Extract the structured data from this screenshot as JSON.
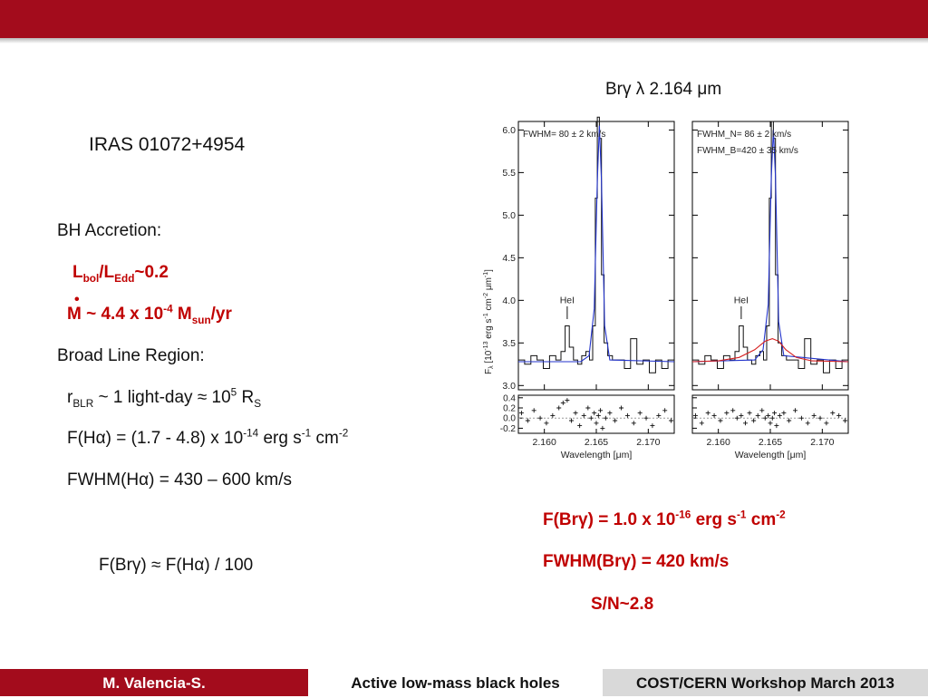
{
  "colors": {
    "brand": "#a30c1c",
    "highlight": "#c00000",
    "fit_line": "#2233cc",
    "broad_component": "#d62020"
  },
  "object_name": "IRAS 01072+4954",
  "bh_accretion": {
    "heading": "BH Accretion:",
    "lratio_L1": "L",
    "lratio_s1": "bol",
    "lratio_slash": "/L",
    "lratio_s2": "Edd",
    "lratio_val": "~0.2",
    "mdot_pre": "M ~ 4.4 x 10",
    "mdot_exp": "-4",
    "mdot_mid": " M",
    "mdot_sub": "sun",
    "mdot_post": "/yr"
  },
  "blr": {
    "heading": "Broad Line Region:",
    "r_pre": "r",
    "r_sub": "BLR",
    "r_mid": " ~ 1 light-day ≈ 10",
    "r_exp": "5",
    "r_mid2": " R",
    "r_sub2": "S",
    "f_pre": "F(Hα) = (1.7 - 4.8) x 10",
    "f_exp1": "-14",
    "f_mid": " erg s",
    "f_exp2": "-1",
    "f_mid2": " cm",
    "f_exp3": "-2",
    "fwhm": "FWHM(Hα) = 430 – 600 km/s"
  },
  "flux_ratio": "F(Brγ) ≈ F(Hα) / 100",
  "brg_title": "Brγ λ 2.164 μm",
  "results": {
    "f_pre": "F(Brγ) = 1.0 x 10",
    "f_exp1": "-16",
    "f_mid": " erg s",
    "f_exp2": "-1",
    "f_mid2": " cm",
    "f_exp3": "-2",
    "fwhm": "FWHM(Brγ) = 420 km/s",
    "sn": "S/N~2.8"
  },
  "footer": {
    "author": "M. Valencia-S.",
    "title": "Active low-mass black holes",
    "event": "COST/CERN Workshop March 2013"
  },
  "chart_data": [
    {
      "type": "line",
      "panel": "left",
      "annotation_fwhm": "FWHM= 80 ± 2 km/s",
      "line_label": "HeI",
      "line_label_x": 2.1622,
      "ylabel": "F_λ [10^-13 erg s^-1 cm^-2 μm^-1]",
      "xlabel": "Wavelength [μm]",
      "xlim": [
        2.1575,
        2.1725
      ],
      "ylim": [
        2.95,
        6.1
      ],
      "xticks": [
        2.16,
        2.165,
        2.17
      ],
      "yticks": [
        3.0,
        3.5,
        4.0,
        4.5,
        5.0,
        5.5,
        6.0
      ],
      "residual_ylim": [
        -0.3,
        0.45
      ],
      "residual_yticks": [
        -0.2,
        0.0,
        0.2,
        0.4
      ],
      "series": [
        {
          "x": [
            2.1578,
            2.1584,
            2.159,
            2.1596,
            2.1602,
            2.1608,
            2.1614,
            2.1618,
            2.1622,
            2.1626,
            2.163,
            2.1634,
            2.1638,
            2.1642,
            2.1645,
            2.1648,
            2.165,
            2.1652,
            2.1654,
            2.1656,
            2.1659,
            2.1663,
            2.1668,
            2.1674,
            2.168,
            2.1686,
            2.1692,
            2.1698,
            2.1704,
            2.171,
            2.1716,
            2.1722
          ],
          "values": [
            3.3,
            3.25,
            3.35,
            3.3,
            3.2,
            3.35,
            3.3,
            3.4,
            3.7,
            3.45,
            3.3,
            3.25,
            3.35,
            3.4,
            3.3,
            3.7,
            5.2,
            6.15,
            5.9,
            4.3,
            3.5,
            3.35,
            3.3,
            3.3,
            3.2,
            3.55,
            3.25,
            3.3,
            3.15,
            3.3,
            3.2,
            3.3
          ]
        },
        {
          "x": [
            2.1575,
            2.1635,
            2.1643,
            2.1648,
            2.1651,
            2.1653,
            2.1655,
            2.1658,
            2.1663,
            2.1725
          ],
          "values": [
            3.28,
            3.28,
            3.35,
            3.9,
            5.4,
            6.05,
            5.4,
            3.7,
            3.3,
            3.28
          ]
        }
      ],
      "residuals": [
        0.1,
        -0.05,
        0.15,
        0.0,
        -0.1,
        0.05,
        0.2,
        0.3,
        0.35,
        -0.05,
        0.1,
        -0.15,
        0.05,
        0.2,
        0.0,
        0.1,
        -0.1,
        0.05,
        0.15,
        -0.2,
        0.0,
        0.1,
        -0.05,
        0.2,
        0.05,
        -0.1,
        0.1,
        0.0,
        -0.15,
        0.05,
        0.15,
        -0.05
      ]
    },
    {
      "type": "line",
      "panel": "right",
      "annotation_fwhm_n": "FWHM_N= 86 ± 2 km/s",
      "annotation_fwhm_b": "FWHM_B=420 ± 35 km/s",
      "line_label": "HeI",
      "line_label_x": 2.1622,
      "xlabel": "Wavelength [μm]",
      "xlim": [
        2.1575,
        2.1725
      ],
      "ylim": [
        2.95,
        6.1
      ],
      "xticks": [
        2.16,
        2.165,
        2.17
      ],
      "series": [
        {
          "x": [
            2.1578,
            2.1584,
            2.159,
            2.1596,
            2.1602,
            2.1608,
            2.1614,
            2.1618,
            2.1622,
            2.1626,
            2.163,
            2.1634,
            2.1638,
            2.1642,
            2.1645,
            2.1648,
            2.165,
            2.1652,
            2.1654,
            2.1656,
            2.1659,
            2.1663,
            2.1668,
            2.1674,
            2.168,
            2.1686,
            2.1692,
            2.1698,
            2.1704,
            2.171,
            2.1716,
            2.1722
          ],
          "values": [
            3.3,
            3.25,
            3.35,
            3.3,
            3.2,
            3.35,
            3.3,
            3.4,
            3.7,
            3.45,
            3.3,
            3.25,
            3.35,
            3.4,
            3.3,
            3.7,
            5.2,
            6.1,
            5.9,
            4.3,
            3.5,
            3.35,
            3.3,
            3.3,
            3.2,
            3.55,
            3.25,
            3.3,
            3.15,
            3.3,
            3.2,
            3.3
          ]
        },
        {
          "x": [
            2.1575,
            2.1635,
            2.1643,
            2.1648,
            2.1651,
            2.1653,
            2.1655,
            2.1658,
            2.1663,
            2.1725
          ],
          "values": [
            3.28,
            3.3,
            3.42,
            3.95,
            5.45,
            6.0,
            5.45,
            3.75,
            3.35,
            3.28
          ]
        },
        {
          "x": [
            2.1575,
            2.16,
            2.162,
            2.1635,
            2.1645,
            2.1652,
            2.1658,
            2.1665,
            2.1675,
            2.169,
            2.1725
          ],
          "values": [
            3.28,
            3.29,
            3.33,
            3.42,
            3.52,
            3.55,
            3.52,
            3.42,
            3.33,
            3.29,
            3.28
          ]
        }
      ],
      "residuals": [
        0.05,
        -0.1,
        0.1,
        0.05,
        -0.05,
        0.1,
        0.15,
        0.0,
        0.05,
        -0.1,
        0.1,
        -0.05,
        0.05,
        0.15,
        0.0,
        0.05,
        -0.1,
        0.0,
        0.1,
        -0.15,
        0.05,
        0.1,
        -0.05,
        0.15,
        0.0,
        -0.1,
        0.05,
        0.0,
        -0.1,
        0.1,
        0.05,
        -0.05
      ]
    }
  ]
}
